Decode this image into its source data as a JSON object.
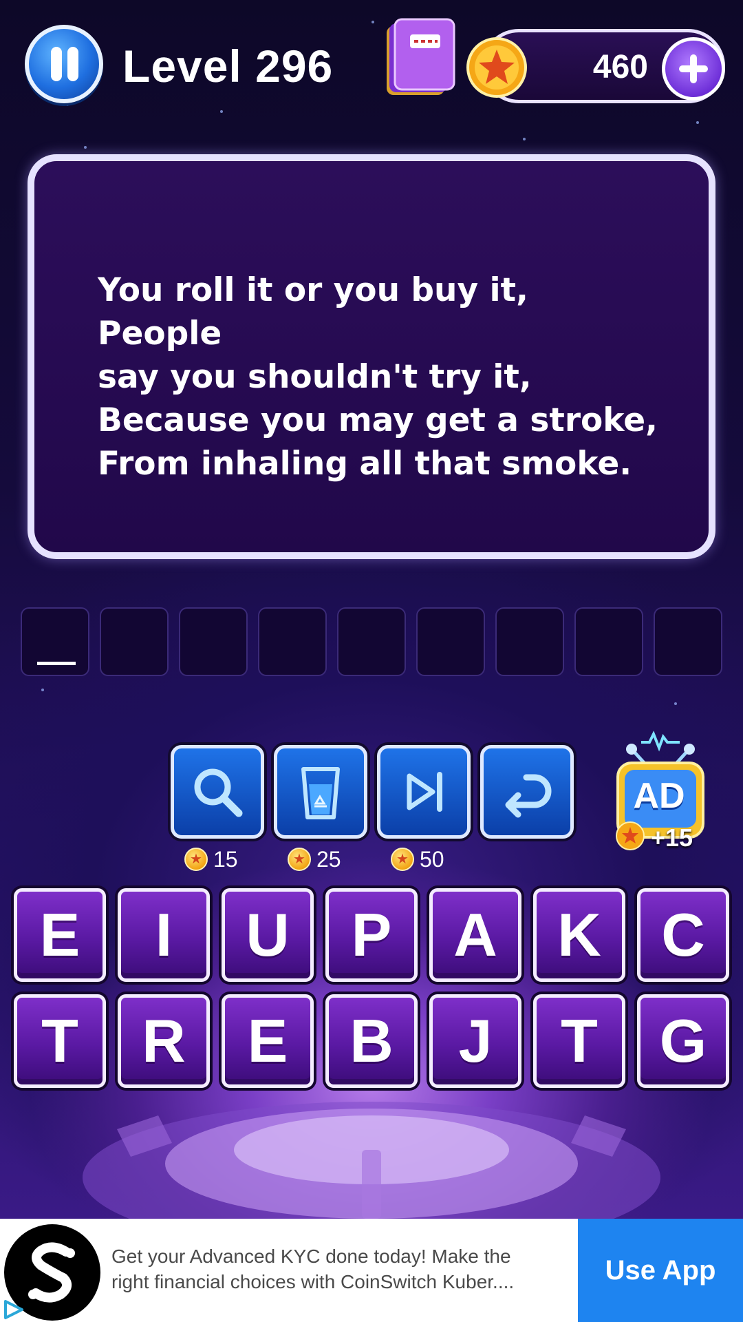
{
  "header": {
    "level_label": "Level 296",
    "coins": "460"
  },
  "riddle": {
    "text": "You roll it or you buy it, People\nsay you shouldn't try it,\nBecause you may get a stroke,\nFrom inhaling all that smoke."
  },
  "answer": {
    "slot_count": 9,
    "letters": [
      "",
      "",
      "",
      "",
      "",
      "",
      "",
      "",
      ""
    ]
  },
  "tools": [
    {
      "name": "reveal-letter",
      "icon": "magnifier-icon",
      "cost": "15"
    },
    {
      "name": "remove-letters",
      "icon": "recycle-bin-icon",
      "cost": "25"
    },
    {
      "name": "skip-level",
      "icon": "skip-forward-icon",
      "cost": "50"
    },
    {
      "name": "undo",
      "icon": "undo-arrow-icon",
      "cost": ""
    }
  ],
  "ad_reward": {
    "label": "AD",
    "reward": "+15"
  },
  "keyboard": {
    "row1": [
      "E",
      "I",
      "U",
      "P",
      "A",
      "K",
      "C"
    ],
    "row2": [
      "T",
      "R",
      "E",
      "B",
      "J",
      "T",
      "G"
    ]
  },
  "ad_banner": {
    "text": "Get your Advanced KYC done today! Make the right financial choices with CoinSwitch Kuber....",
    "cta": "Use App"
  },
  "colors": {
    "background_top": "#0d0828",
    "card_fill": "#21084a",
    "key_purple": "#5a19a3",
    "tool_blue": "#1f73e8",
    "coin_gold": "#f3a514",
    "cta_blue": "#1e84f0"
  }
}
